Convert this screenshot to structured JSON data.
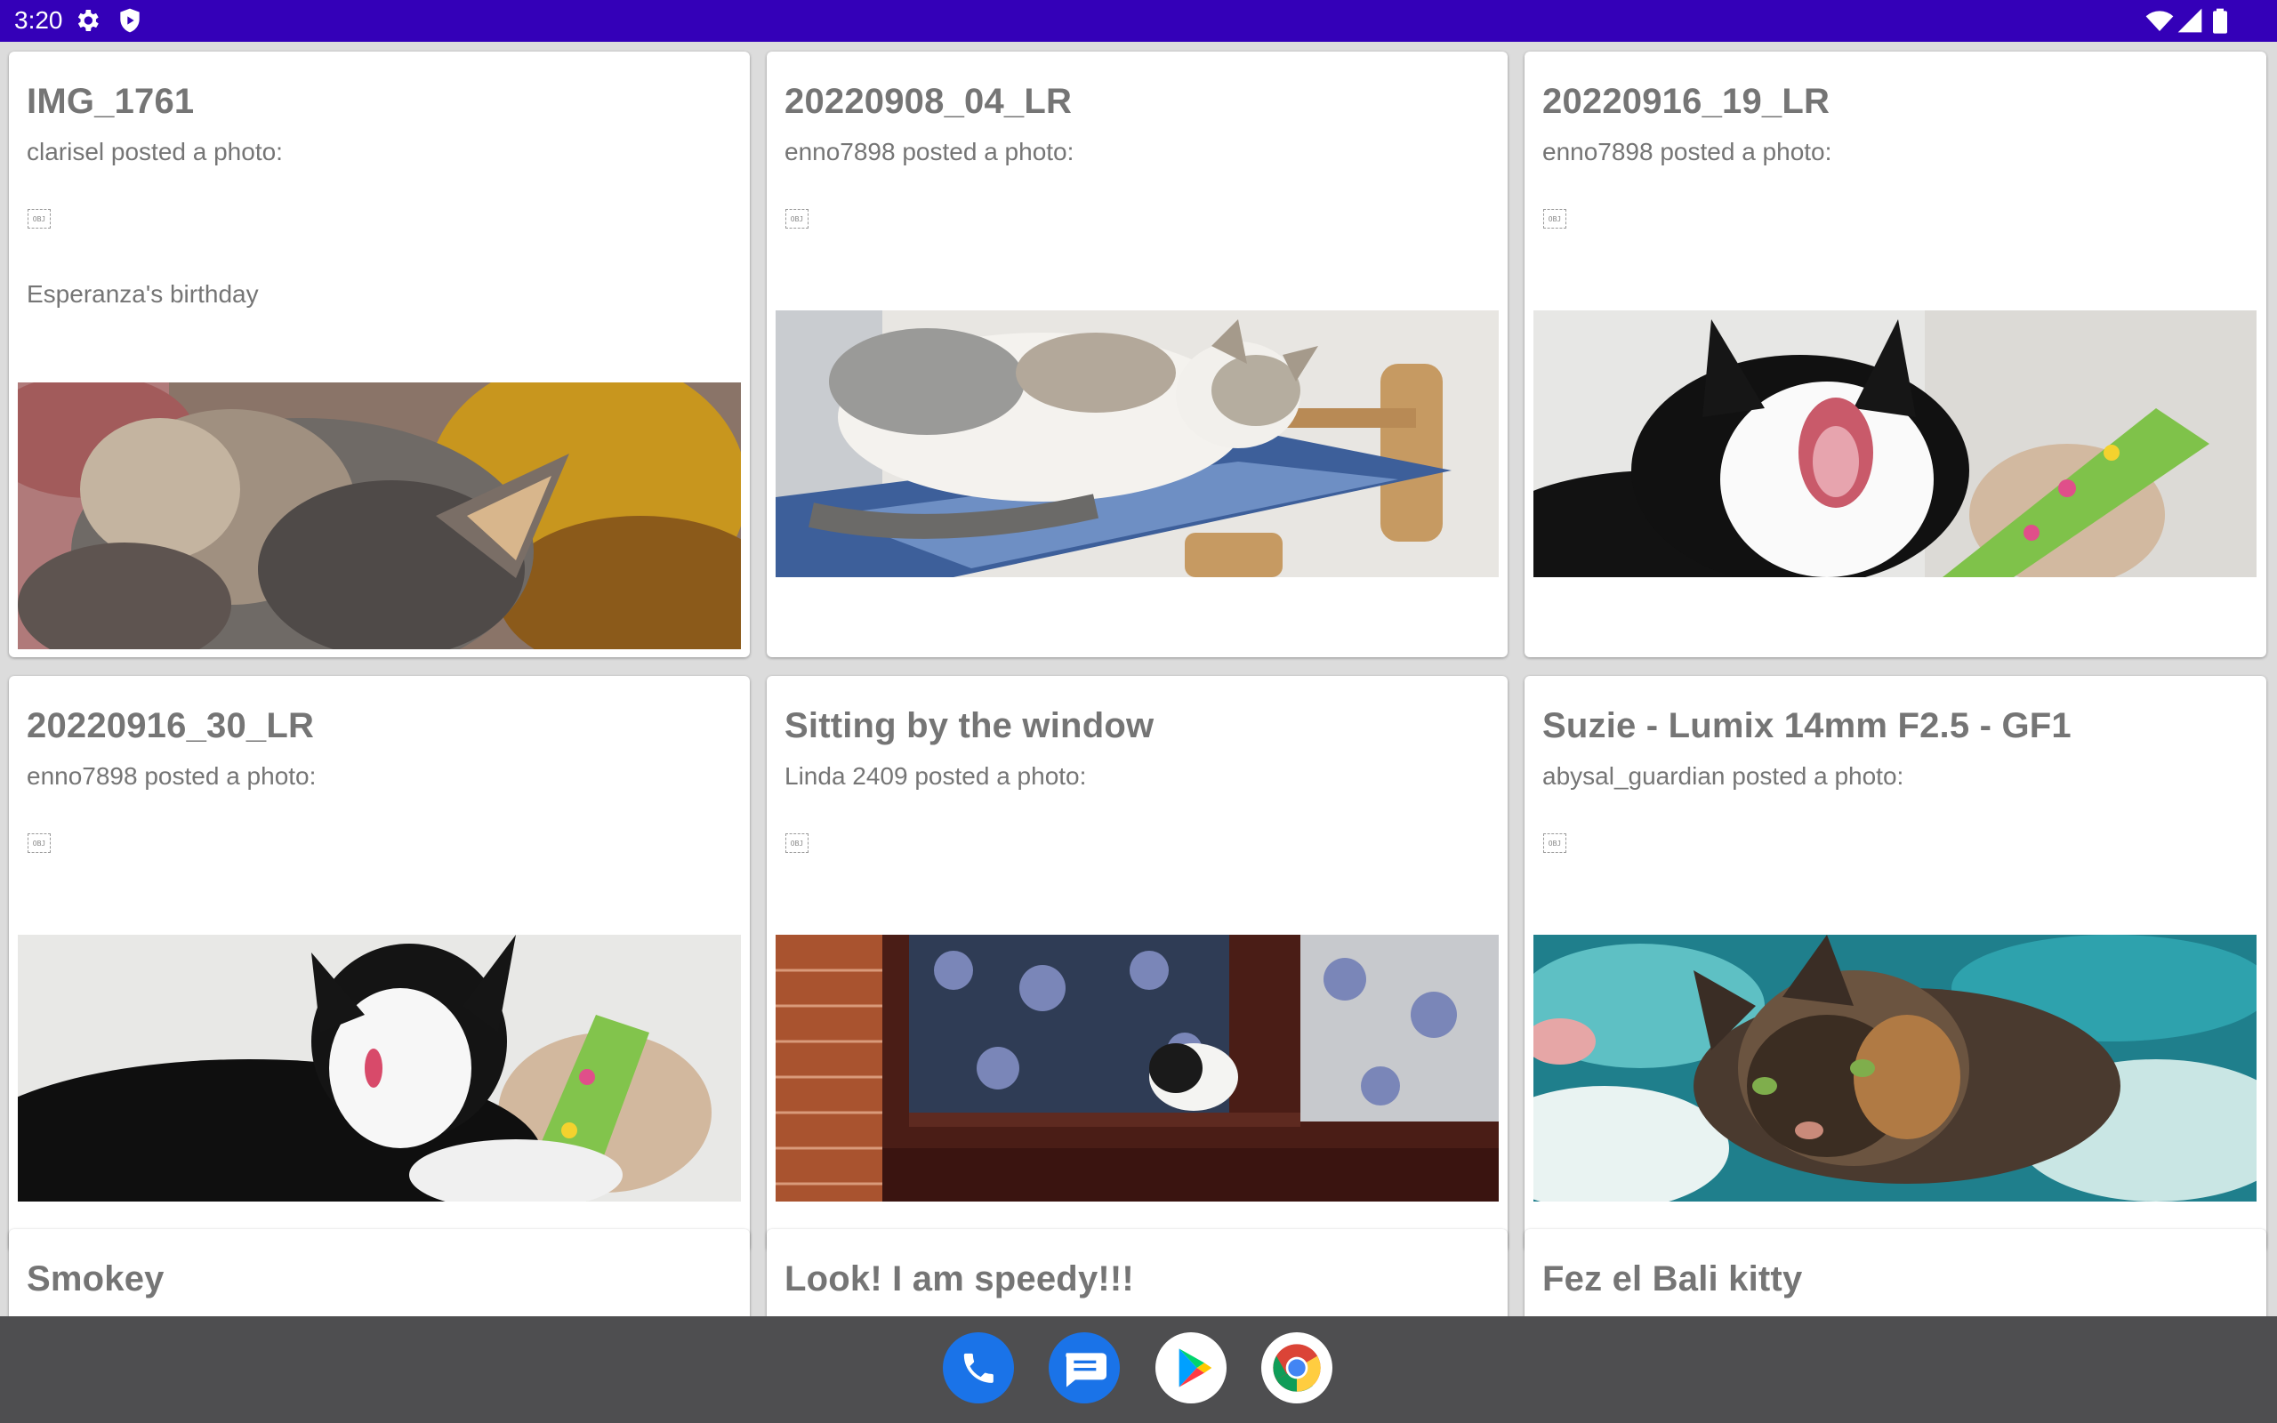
{
  "status_bar": {
    "time": "3:20",
    "left_icons": [
      "gear-icon",
      "shield-icon"
    ],
    "right_icons": [
      "wifi-icon",
      "signal-icon",
      "battery-icon"
    ],
    "color": "#3400b8"
  },
  "feed": {
    "cards": [
      {
        "title": "IMG_1761",
        "byline": "clarisel posted a photo:",
        "obj_label": "OBJ",
        "caption": "Esperanza's birthday",
        "photo": "calico kitten close-up"
      },
      {
        "title": "20220908_04_LR",
        "byline": "enno7898 posted a photo:",
        "obj_label": "OBJ",
        "caption": "",
        "photo": "cat lying on blue hammock"
      },
      {
        "title": "20220916_19_LR",
        "byline": "enno7898 posted a photo:",
        "obj_label": "OBJ",
        "caption": "",
        "photo": "black and white cat yawning"
      },
      {
        "title": "20220916_30_LR",
        "byline": "enno7898 posted a photo:",
        "obj_label": "OBJ",
        "caption": "",
        "photo": "black and white cat licking"
      },
      {
        "title": "Sitting by the window",
        "byline": "Linda 2409 posted a photo:",
        "obj_label": "OBJ",
        "caption": "",
        "photo": "cat in window with floral curtain"
      },
      {
        "title": "Suzie - Lumix 14mm F2.5 - GF1",
        "byline": "abysal_guardian posted a photo:",
        "obj_label": "OBJ",
        "caption": "",
        "photo": "tortoiseshell cat on blanket"
      },
      {
        "title": "Smokey",
        "byline": "",
        "obj_label": "",
        "caption": "",
        "photo": ""
      },
      {
        "title": "Look! I am speedy!!!",
        "byline": "",
        "obj_label": "",
        "caption": "",
        "photo": ""
      },
      {
        "title": "Fez el Bali kitty",
        "byline": "",
        "obj_label": "",
        "caption": "",
        "photo": ""
      }
    ]
  },
  "dock": {
    "apps": [
      {
        "name": "Phone",
        "icon": "phone-icon",
        "color": "#1a73e8"
      },
      {
        "name": "Messages",
        "icon": "messages-icon",
        "color": "#1a73e8"
      },
      {
        "name": "Play Store",
        "icon": "play-store-icon",
        "color": "#ffffff"
      },
      {
        "name": "Chrome",
        "icon": "chrome-icon",
        "color": "#ffffff"
      }
    ]
  }
}
